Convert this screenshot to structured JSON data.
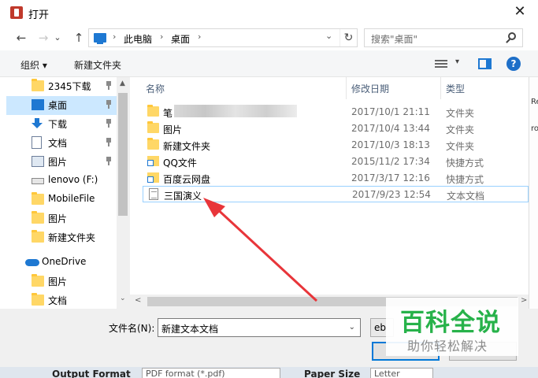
{
  "window": {
    "title": "打开",
    "close_symbol": "✕"
  },
  "nav": {
    "back_symbol": "←",
    "forward_symbol": "→",
    "dropdown_symbol": "⌄",
    "up_symbol": "↑"
  },
  "address": {
    "crumbs": [
      "此电脑",
      "桌面"
    ],
    "separator": "›",
    "dropdown_symbol": "⌄",
    "refresh_symbol": "↻"
  },
  "search": {
    "placeholder": "搜索\"桌面\""
  },
  "toolbar": {
    "organize": "组织 ▾",
    "new_folder": "新建文件夹",
    "view_dropdown_symbol": "▾",
    "help_label": "?"
  },
  "sidebar": {
    "items": [
      {
        "label": "2345下载",
        "icon": "folder-icon",
        "pinned": true
      },
      {
        "label": "桌面",
        "icon": "desktop-icon",
        "pinned": true,
        "selected": true
      },
      {
        "label": "下载",
        "icon": "download-icon",
        "pinned": true
      },
      {
        "label": "文档",
        "icon": "document-icon",
        "pinned": true
      },
      {
        "label": "图片",
        "icon": "picture-icon",
        "pinned": true
      },
      {
        "label": "lenovo (F:)",
        "icon": "drive-icon",
        "pinned": false
      },
      {
        "label": "MobileFile",
        "icon": "folder-icon",
        "pinned": false
      },
      {
        "label": "图片",
        "icon": "folder-icon",
        "pinned": false
      },
      {
        "label": "新建文件夹",
        "icon": "folder-icon",
        "pinned": false
      },
      {
        "label": "OneDrive",
        "icon": "onedrive-icon",
        "pinned": false
      },
      {
        "label": "图片",
        "icon": "folder-icon",
        "pinned": false
      },
      {
        "label": "文档",
        "icon": "folder-icon",
        "pinned": false
      }
    ],
    "scroll_up_symbol": "▲",
    "scroll_down_symbol": "⌄"
  },
  "files": {
    "columns": {
      "name": "名称",
      "date": "修改日期",
      "type": "类型"
    },
    "sort_symbol": "^",
    "rows": [
      {
        "name": "笔",
        "date": "2017/10/1 21:11",
        "type": "文件夹",
        "icon": "folder-icon"
      },
      {
        "name": "图片",
        "date": "2017/10/4 13:44",
        "type": "文件夹",
        "icon": "folder-icon"
      },
      {
        "name": "新建文件夹",
        "date": "2017/10/3 18:13",
        "type": "文件夹",
        "icon": "folder-icon"
      },
      {
        "name": "QQ文件",
        "date": "2015/11/2 17:34",
        "type": "快捷方式",
        "icon": "shortcut-icon"
      },
      {
        "name": "百度云网盘",
        "date": "2017/3/17 12:16",
        "type": "快捷方式",
        "icon": "shortcut-icon"
      },
      {
        "name": "三国演义",
        "date": "2017/9/23 12:54",
        "type": "文本文档",
        "icon": "text-file-icon",
        "selected": true
      }
    ],
    "scroll_left_symbol": "<",
    "scroll_right_symbol": ">"
  },
  "background_window": {
    "texts": [
      "Re",
      "ro"
    ]
  },
  "bottom": {
    "filename_label": "文件名(N):",
    "filename_value": "新建文本文档",
    "filename_dropdown_symbol": "⌄",
    "filetype_value": "eb"
  },
  "background_app": {
    "output_label": "Output Format",
    "output_value": "PDF format (*.pdf)",
    "paper_label": "Paper Size",
    "paper_value": "Letter"
  },
  "watermark": {
    "main": "百科全说",
    "sub": "助你轻松解决"
  },
  "colors": {
    "accent": "#1e78d2",
    "selection": "#cce8ff",
    "annotation_arrow": "#e8353a",
    "watermark_green": "#27b24a"
  }
}
